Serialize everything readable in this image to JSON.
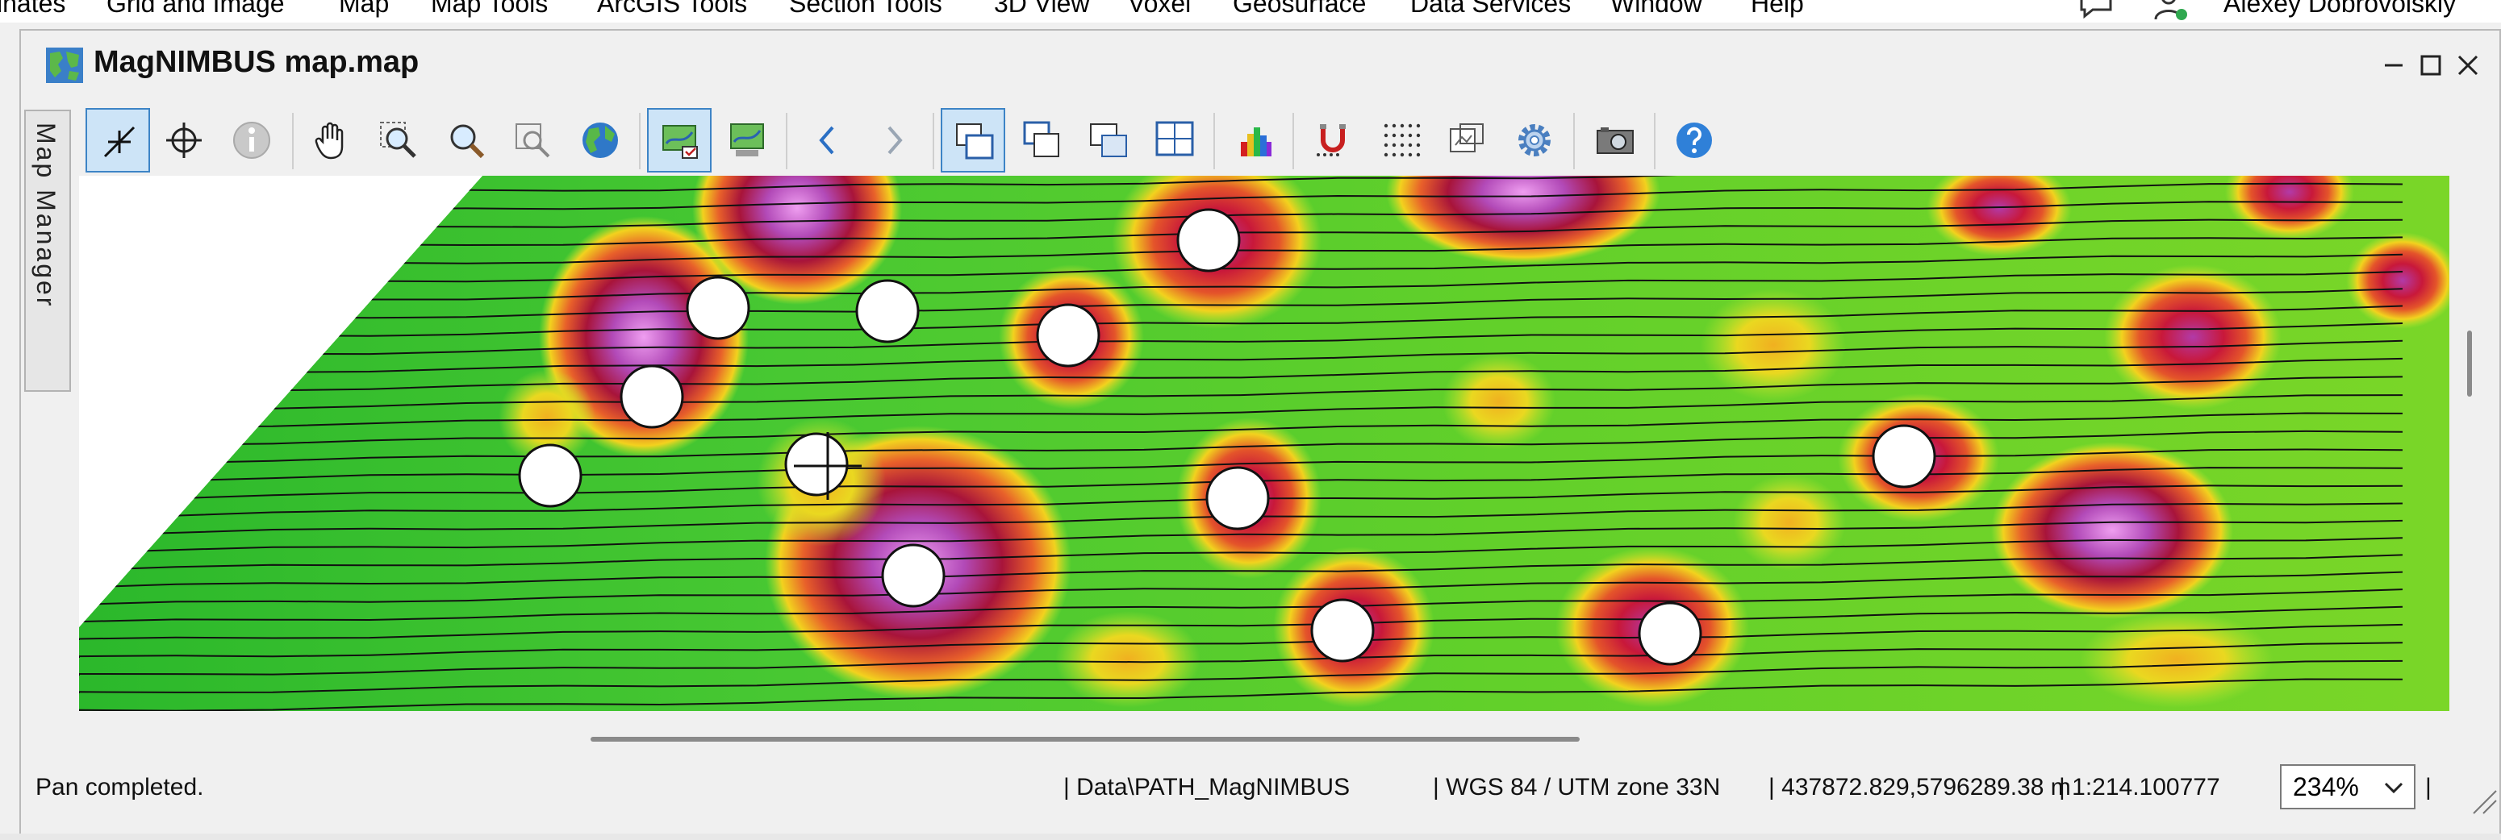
{
  "menubar": {
    "items": [
      "inates",
      "Grid and Image",
      "Map",
      "Map Tools",
      "ArcGIS Tools",
      "Section Tools",
      "3D View",
      "Voxel",
      "Geosurface",
      "Data Services",
      "Window",
      "Help"
    ],
    "user_name": "Alexey Dobrovolskiy"
  },
  "window": {
    "title": "MagNIMBUS map.map"
  },
  "side_tab": {
    "label": "Map Manager"
  },
  "toolbar": {
    "buttons": [
      "select-tool",
      "digitize-tool",
      "info-tool",
      "pan-tool",
      "zoom-to-tool",
      "zoom-tool",
      "zoom-box-tool",
      "globe-tool",
      "map-group-tool",
      "map-view-tool",
      "back-tool",
      "forward-tool",
      "layout-1-tool",
      "layout-2-tool",
      "layout-3-tool",
      "layout-4-tool",
      "color-bar-tool",
      "snap-tool",
      "grid-tool",
      "map-tool",
      "settings-tool",
      "screenshot-tool",
      "help-tool"
    ]
  },
  "status": {
    "message": "Pan completed.",
    "path": "| Data\\PATH_MagNIMBUS",
    "projection": "| WGS 84 / UTM zone 33N",
    "coordinates": "| 437872.829,5796289.38 m",
    "scale": "| 1:214.100777",
    "zoom": "234%",
    "end_separator": "|"
  },
  "colors": {
    "window_bg": "#f0f0f0",
    "active_tool_bg": "#cde4f7",
    "active_tool_border": "#3d84c6",
    "map_low": "#28c628",
    "map_mid": "#e8e800",
    "map_high": "#c41a3a",
    "map_peak": "#b04ab8"
  }
}
